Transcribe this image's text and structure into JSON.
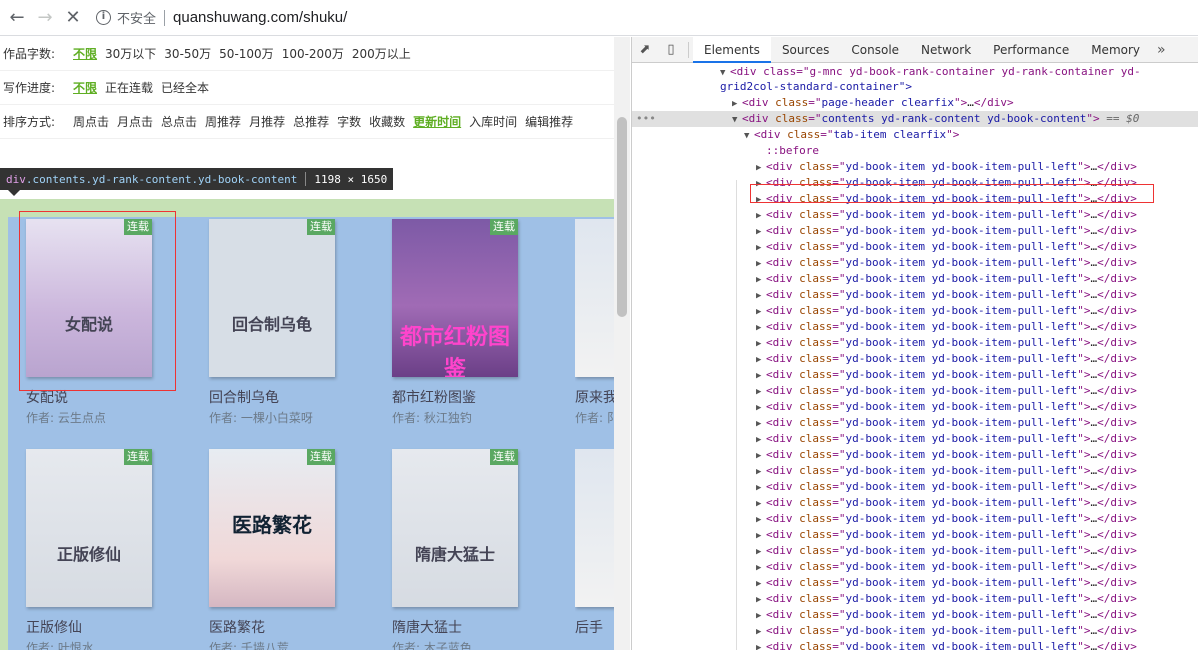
{
  "browser": {
    "security_label": "不安全",
    "url": "quanshuwang.com/shuku/"
  },
  "filters": [
    {
      "label": "作品字数:",
      "options": [
        "不限",
        "30万以下",
        "30-50万",
        "50-100万",
        "100-200万",
        "200万以上"
      ],
      "active": 0
    },
    {
      "label": "写作进度:",
      "options": [
        "不限",
        "正在连载",
        "已经全本"
      ],
      "active": 0
    },
    {
      "label": "排序方式:",
      "options": [
        "周点击",
        "月点击",
        "总点击",
        "周推荐",
        "月推荐",
        "总推荐",
        "字数",
        "收藏数",
        "更新时间",
        "入库时间",
        "编辑推荐"
      ],
      "active": 8
    }
  ],
  "tooltip": {
    "tag": "div",
    "classes": ".contents.yd-rank-content.yd-book-content",
    "size": "1198 × 1650"
  },
  "books": [
    {
      "title": "女配说",
      "author": "作者: 云生点点",
      "badge": "连载",
      "cover_text": "女配说"
    },
    {
      "title": "回合制乌龟",
      "author": "作者: 一棵小白菜呀",
      "badge": "连载",
      "cover_text": "回合制乌龟"
    },
    {
      "title": "都市红粉图鉴",
      "author": "作者: 秋江独钓",
      "badge": "连载",
      "cover_text": "都市红粉图鉴"
    },
    {
      "title": "原来我",
      "author": "作者: 阝",
      "badge": "",
      "cover_text": ""
    },
    {
      "title": "正版修仙",
      "author": "作者: 叶恨水",
      "badge": "连载",
      "cover_text": "正版修仙"
    },
    {
      "title": "医路繁花",
      "author": "作者: 千墙八荒",
      "badge": "连载",
      "cover_text": "医路繁花"
    },
    {
      "title": "隋唐大猛士",
      "author": "作者: 木子蓝色",
      "badge": "连载",
      "cover_text": "隋唐大猛士"
    },
    {
      "title": "后手",
      "author": "",
      "badge": "",
      "cover_text": ""
    }
  ],
  "devtools": {
    "tabs": [
      "Elements",
      "Sources",
      "Console",
      "Network",
      "Performance",
      "Memory"
    ],
    "more": "»",
    "tree": {
      "l0": "<div class=\"g-mnc yd-book-rank-container yd-rank-container yd-",
      "l0b": "grid2col-standard-container\">",
      "l1_tag": "div",
      "l1_class": "page-header clearfix",
      "l2_tag": "div",
      "l2_class": "contents yd-rank-content yd-book-content",
      "l2_suffix": "== $0",
      "l3_tag": "div",
      "l3_class": "tab-item clearfix",
      "pseudo": "::before",
      "item_class": "yd-book-item yd-book-item-pull-left",
      "item_count": 31
    }
  }
}
